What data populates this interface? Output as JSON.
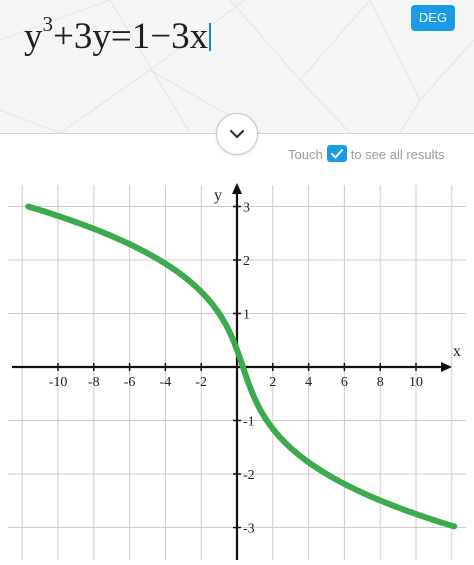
{
  "input": {
    "equation_parts": {
      "y": "y",
      "exp": "3",
      "rest": "+3y=1−3x"
    }
  },
  "header": {
    "deg_label": "DEG",
    "expand_icon": "chevron-down-icon"
  },
  "results_hint": {
    "prefix": "Touch",
    "suffix": "to see all results",
    "icon": "check-icon"
  },
  "colors": {
    "accent": "#1a9be6",
    "curve": "#3daa4d",
    "grid": "#cccccc",
    "axis": "#111111"
  },
  "chart_data": {
    "type": "line",
    "equation": "y^3+3y=1-3x",
    "xlabel": "x",
    "ylabel": "y",
    "xlim": [
      -12.6,
      12.3
    ],
    "ylim": [
      -3.6,
      3.3
    ],
    "x_ticks": [
      -10,
      -8,
      -6,
      -4,
      -2,
      2,
      4,
      6,
      8,
      10
    ],
    "y_ticks": [
      -3,
      -2,
      -1,
      1,
      2,
      3
    ],
    "grid": true,
    "series": [
      {
        "x": [
          -12.6,
          -12,
          -10,
          -8,
          -6,
          -4,
          -2,
          -1,
          0,
          1,
          2,
          4,
          6,
          8,
          10,
          12,
          12.3
        ],
        "y": [
          3.0,
          2.95,
          2.77,
          2.57,
          2.34,
          2.06,
          1.67,
          1.37,
          0.32,
          -1.0,
          -1.43,
          -1.96,
          -2.32,
          -2.59,
          -2.82,
          -3.02,
          -3.05
        ]
      }
    ]
  }
}
